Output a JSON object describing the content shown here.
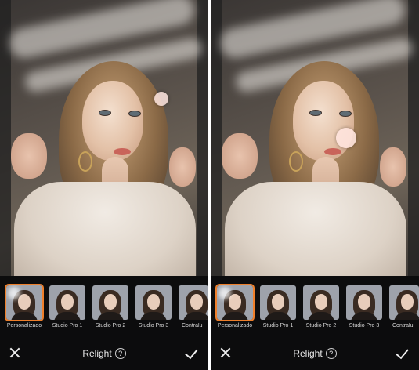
{
  "panels": [
    {
      "id": "left",
      "presets": [
        {
          "label": "Personalizado",
          "selected": true
        },
        {
          "label": "Studio Pro 1",
          "selected": false
        },
        {
          "label": "Studio Pro 2",
          "selected": false
        },
        {
          "label": "Studio Pro 3",
          "selected": false
        },
        {
          "label": "Contralu",
          "selected": false
        }
      ],
      "toolbar": {
        "title": "Relight",
        "help_glyph": "?",
        "close_icon": "close-icon",
        "confirm_icon": "check-icon"
      }
    },
    {
      "id": "right",
      "presets": [
        {
          "label": "Personalizado",
          "selected": true
        },
        {
          "label": "Studio Pro 1",
          "selected": false
        },
        {
          "label": "Studio Pro 2",
          "selected": false
        },
        {
          "label": "Studio Pro 3",
          "selected": false
        },
        {
          "label": "Contralu",
          "selected": false
        }
      ],
      "toolbar": {
        "title": "Relight",
        "help_glyph": "?",
        "close_icon": "close-icon",
        "confirm_icon": "check-icon"
      }
    }
  ],
  "colors": {
    "accent": "#ee7f2b",
    "background": "#0c0c0d",
    "text": "#eaeaea"
  }
}
